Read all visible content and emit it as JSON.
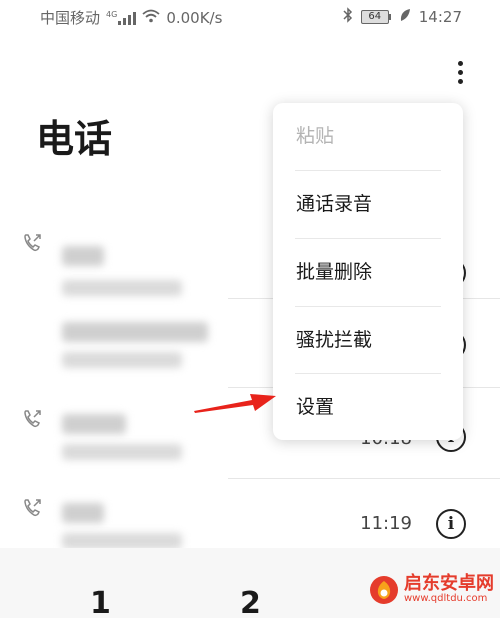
{
  "status_bar": {
    "carrier": "中国移动",
    "network": "4G",
    "speed": "0.00K/s",
    "battery": "64",
    "time": "14:27"
  },
  "header": {
    "title": "电话"
  },
  "call_log": {
    "rows": [
      {
        "name": "",
        "detail": "",
        "time": ""
      },
      {
        "name": "",
        "detail": "",
        "time": ""
      },
      {
        "name": "",
        "detail": "",
        "time": "10:18"
      },
      {
        "name": "",
        "detail": "",
        "time": "11:19"
      }
    ]
  },
  "menu": {
    "items": [
      {
        "label": "粘贴",
        "enabled": false
      },
      {
        "label": "通话录音",
        "enabled": true
      },
      {
        "label": "批量删除",
        "enabled": true
      },
      {
        "label": "骚扰拦截",
        "enabled": true
      },
      {
        "label": "设置",
        "enabled": true
      }
    ]
  },
  "dialpad": {
    "key1": "1",
    "key2": "2"
  },
  "watermark": {
    "title": "启东安卓网",
    "url": "www.qdltdu.com"
  },
  "colors": {
    "annotation_arrow": "#e8231b",
    "watermark": "#e53c2c"
  },
  "icons": [
    "call-outgoing-icon",
    "more-vertical-icon",
    "info-icon",
    "signal-icon",
    "wifi-icon",
    "bluetooth-icon",
    "battery-icon",
    "leaf-icon"
  ]
}
